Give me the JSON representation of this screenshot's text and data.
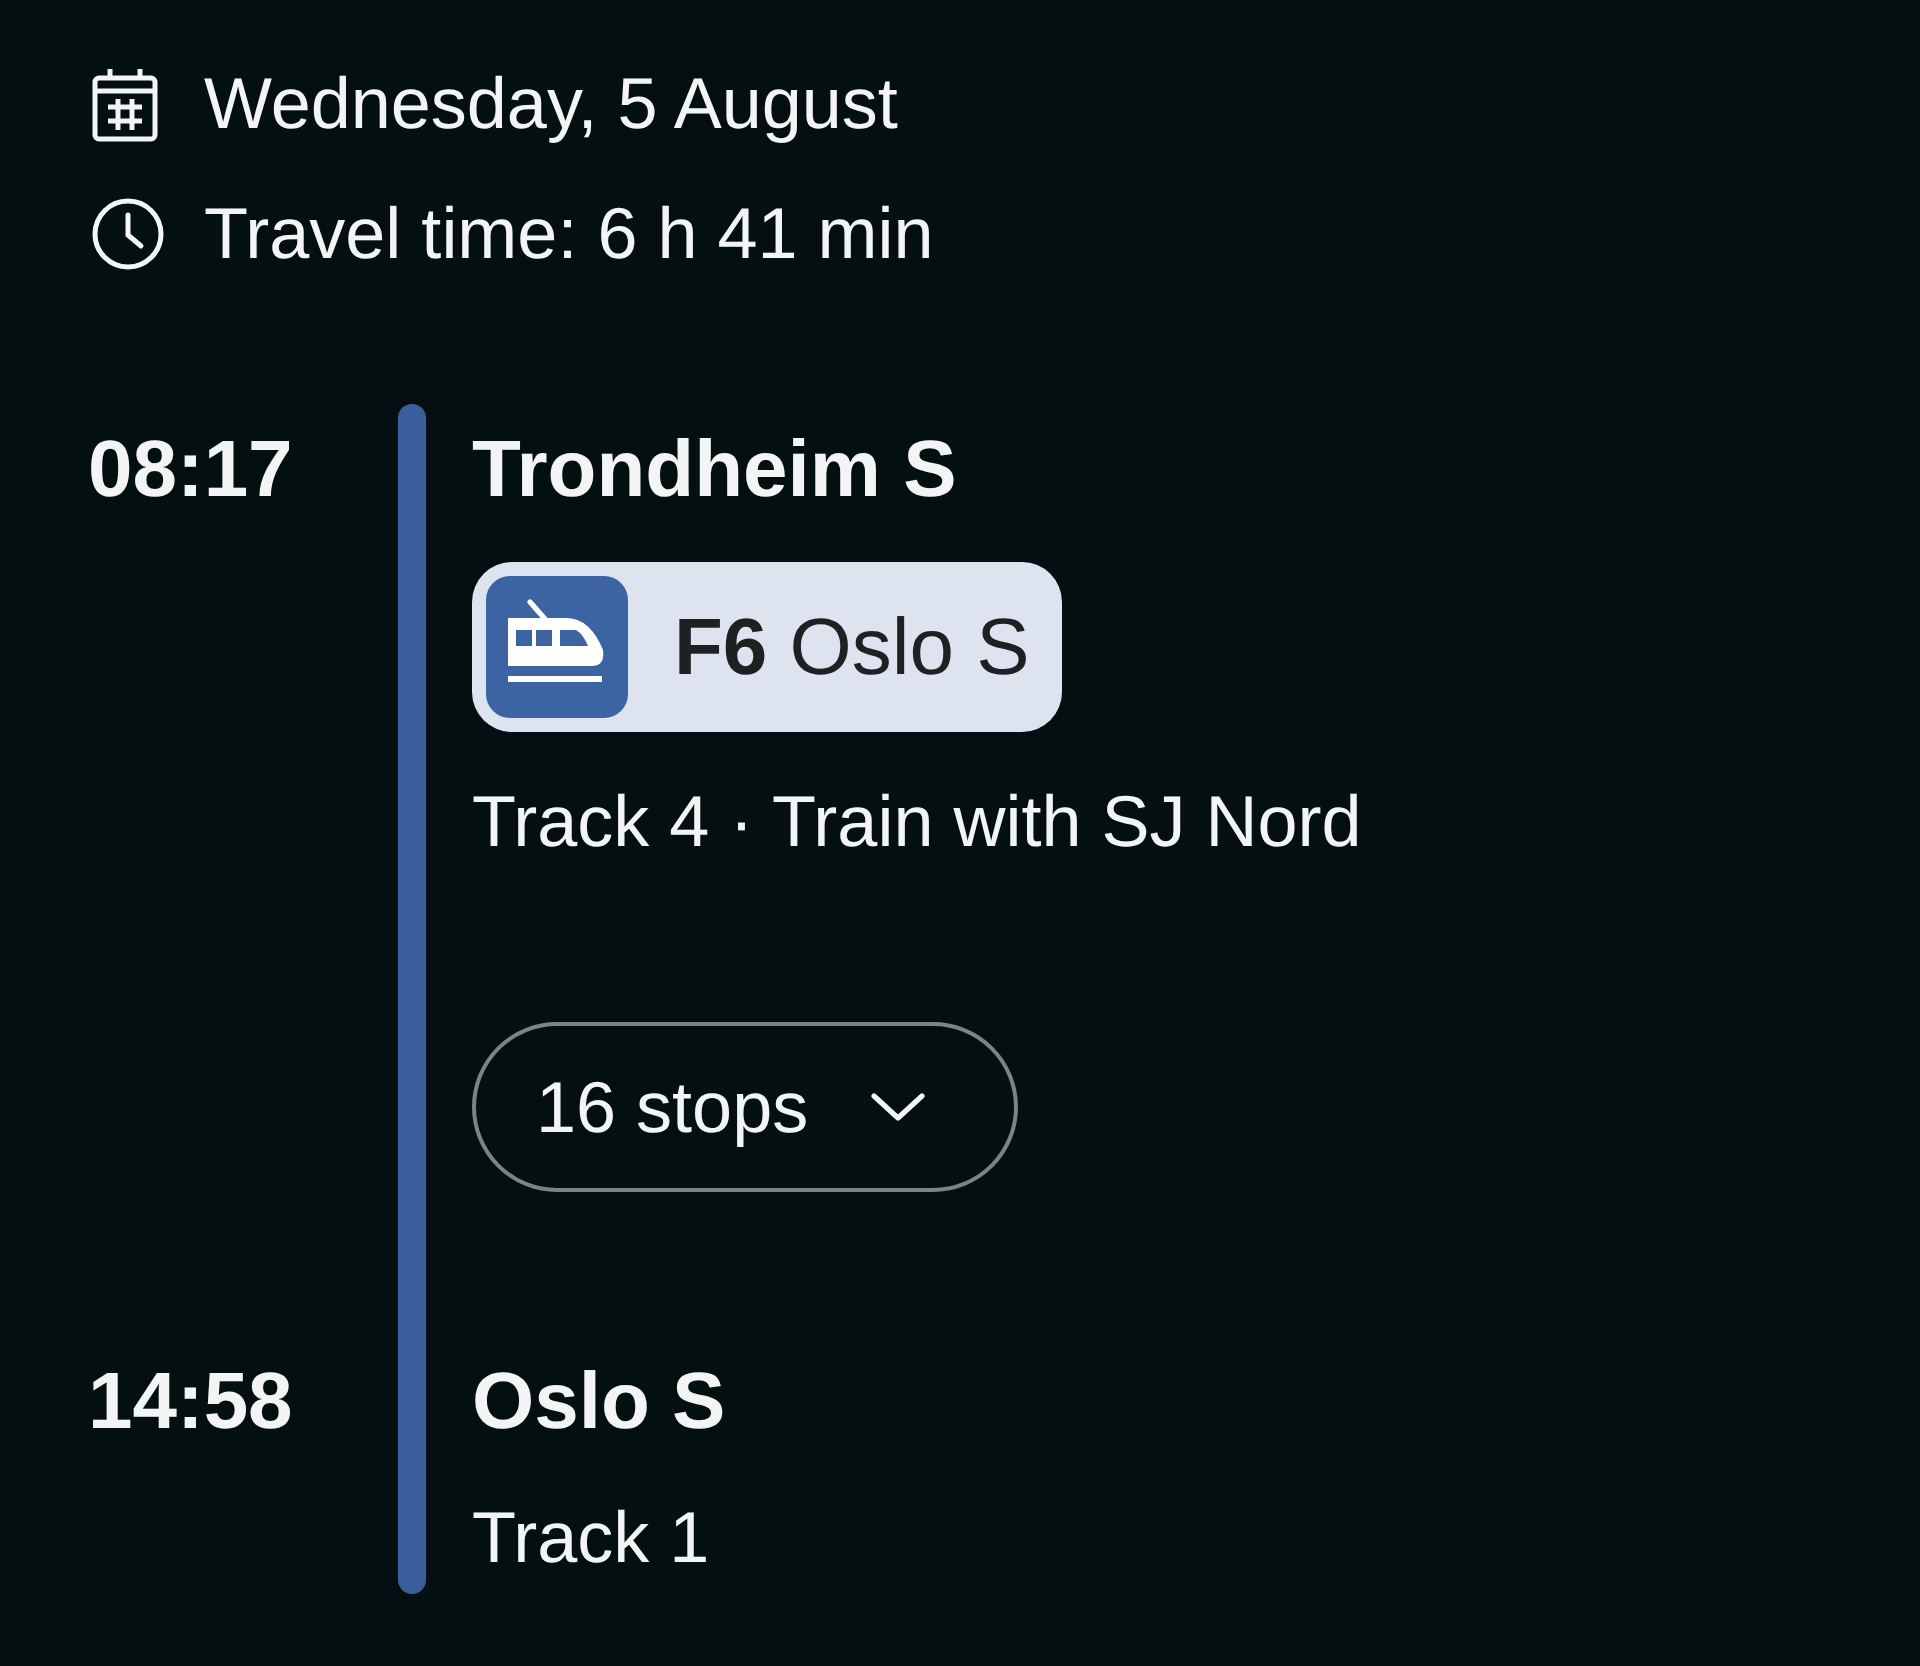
{
  "header": [
    {
      "kind": "date",
      "text": "Wednesday, 5 August"
    },
    {
      "kind": "duration",
      "text": "Travel time: 6 h 41 min"
    }
  ],
  "journey": {
    "departure": {
      "time": "08:17",
      "station": "Trondheim S"
    },
    "service": {
      "label": "**F6** Oslo S"
    },
    "info": "Track 4 · Train with SJ Nord",
    "stops_toggle": {
      "label": "16 stops",
      "expanded": false
    },
    "arrival": {
      "time": "14:58",
      "station": "Oslo S",
      "track": "Track 1"
    }
  }
}
